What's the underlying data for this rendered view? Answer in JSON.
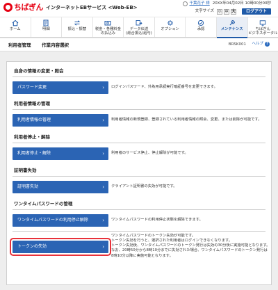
{
  "header": {
    "logo_text": "ちばぎん",
    "service_name": "インターネットEBサービス <Web-EB>",
    "user_name": "千葉花子 様",
    "last_login": "20XX年04月02日 10時00分00秒",
    "font_size_label": "文字サイズ",
    "font_size_small": "小",
    "font_size_medium": "中",
    "font_size_large": "大",
    "logout_label": "ログアウト"
  },
  "nav": [
    {
      "label": "ホーム",
      "icon": "home-icon",
      "active": false
    },
    {
      "label": "明細",
      "icon": "statement-icon",
      "active": false
    },
    {
      "label": "振込・振替",
      "icon": "transfer-icon",
      "active": false
    },
    {
      "label": "税金・各種料金\nの払込み",
      "icon": "tax-payment-icon",
      "active": false
    },
    {
      "label": "データ伝送\n(総合振込/給与)",
      "icon": "data-transmission-icon",
      "active": false
    },
    {
      "label": "オプション",
      "icon": "option-icon",
      "active": false
    },
    {
      "label": "承認",
      "icon": "approval-icon",
      "active": false
    },
    {
      "label": "メンテナンス",
      "icon": "maintenance-icon",
      "active": true
    },
    {
      "label": "ちばぎん\nビジネスポータル",
      "icon": "portal-icon",
      "active": false
    }
  ],
  "title": {
    "section": "利用者管理",
    "page": "作業内容選択",
    "screen_code": "BRSK001",
    "help_label": "ヘルプ",
    "help_icon": "?"
  },
  "sections": [
    {
      "heading": "自身の情報の変更・照会",
      "button": "パスワード変更",
      "desc": [
        "ログインパスワード、外為用承認実行暗証番号を変更できます。"
      ],
      "highlight": false
    },
    {
      "heading": "利用者情報の管理",
      "button": "利用者情報の管理",
      "desc": [
        "利用者情報の新規登録、登録されている利用者情報の照会、変更、または削除が可能です。"
      ],
      "highlight": false
    },
    {
      "heading": "利用者停止・解除",
      "button": "利用者停止・解除",
      "desc": [
        "利用者のサービス停止、停止解除が可能です。"
      ],
      "highlight": false
    },
    {
      "heading": "証明書失効",
      "button": "証明書失効",
      "desc": [
        "クライアント証明書の失効が可能です。"
      ],
      "highlight": false
    },
    {
      "heading": "ワンタイムパスワードの管理",
      "button": "ワンタイムパスワードの利用停止解除",
      "desc": [
        "ワンタイムパスワードの利用停止状態を解除できます。"
      ],
      "highlight": false
    },
    {
      "heading": "",
      "button": "トークンの失効",
      "desc": [
        "ワンタイムパスワードのトークン失効が可能です。",
        "トークン失効を行うと、選択された利用者はログインできなくなります。",
        "トークン失効後、ワンタイムパスワードのトークン発行は失効の30分後に実施可能となります。",
        "なお、20時50分から8時10分までに失効された場合、ワンタイムパスワードのトークン発行は",
        "8時10分以降に実施可能となります。"
      ],
      "highlight": true
    }
  ],
  "colors": {
    "brand_red": "#e60012",
    "primary_blue": "#2b64b4",
    "highlight_red": "#e8313a"
  }
}
